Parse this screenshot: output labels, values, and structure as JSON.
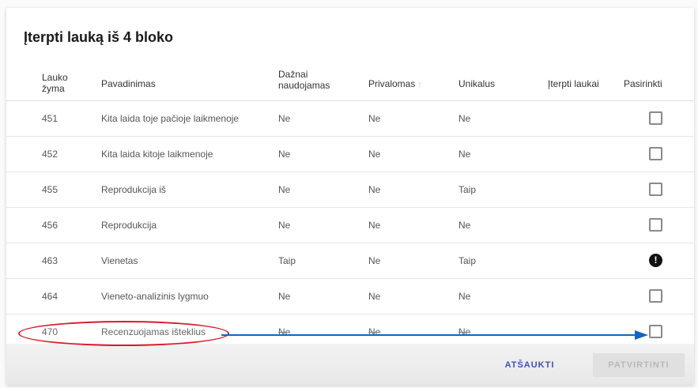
{
  "dialog": {
    "title": "Įterpti lauką iš 4 bloko"
  },
  "table": {
    "headers": {
      "code": "Lauko žyma",
      "name": "Pavadinimas",
      "frequent": "Dažnai naudojamas",
      "required": "Privalomas",
      "required_sort_icon": "↑",
      "unique": "Unikalus",
      "inserted": "Įterpti laukai",
      "select": "Pasirinkti"
    },
    "rows": [
      {
        "code": "451",
        "name": "Kita laida toje pačioje laikmenoje",
        "frequent": "Ne",
        "required": "Ne",
        "unique": "Ne",
        "select": "checkbox"
      },
      {
        "code": "452",
        "name": "Kita laida kitoje laikmenoje",
        "frequent": "Ne",
        "required": "Ne",
        "unique": "Ne",
        "select": "checkbox"
      },
      {
        "code": "455",
        "name": "Reprodukcija iš",
        "frequent": "Ne",
        "required": "Ne",
        "unique": "Taip",
        "select": "checkbox"
      },
      {
        "code": "456",
        "name": "Reprodukcija",
        "frequent": "Ne",
        "required": "Ne",
        "unique": "Ne",
        "select": "checkbox"
      },
      {
        "code": "463",
        "name": "Vienetas",
        "frequent": "Taip",
        "required": "Ne",
        "unique": "Taip",
        "select": "alert-icon",
        "alert_glyph": "!"
      },
      {
        "code": "464",
        "name": "Vieneto-analizinis lygmuo",
        "frequent": "Ne",
        "required": "Ne",
        "unique": "Ne",
        "select": "checkbox"
      },
      {
        "code": "470",
        "name": "Recenzuojamas išteklius",
        "frequent": "Ne",
        "required": "Ne",
        "unique": "Ne",
        "select": "checkbox"
      }
    ]
  },
  "footer": {
    "cancel_label": "ATŠAUKTI",
    "apply_label": "PATVIRTINTI"
  },
  "annotations": {
    "ellipse_color": "#d81b2a",
    "arrow_color": "#1565c0"
  }
}
